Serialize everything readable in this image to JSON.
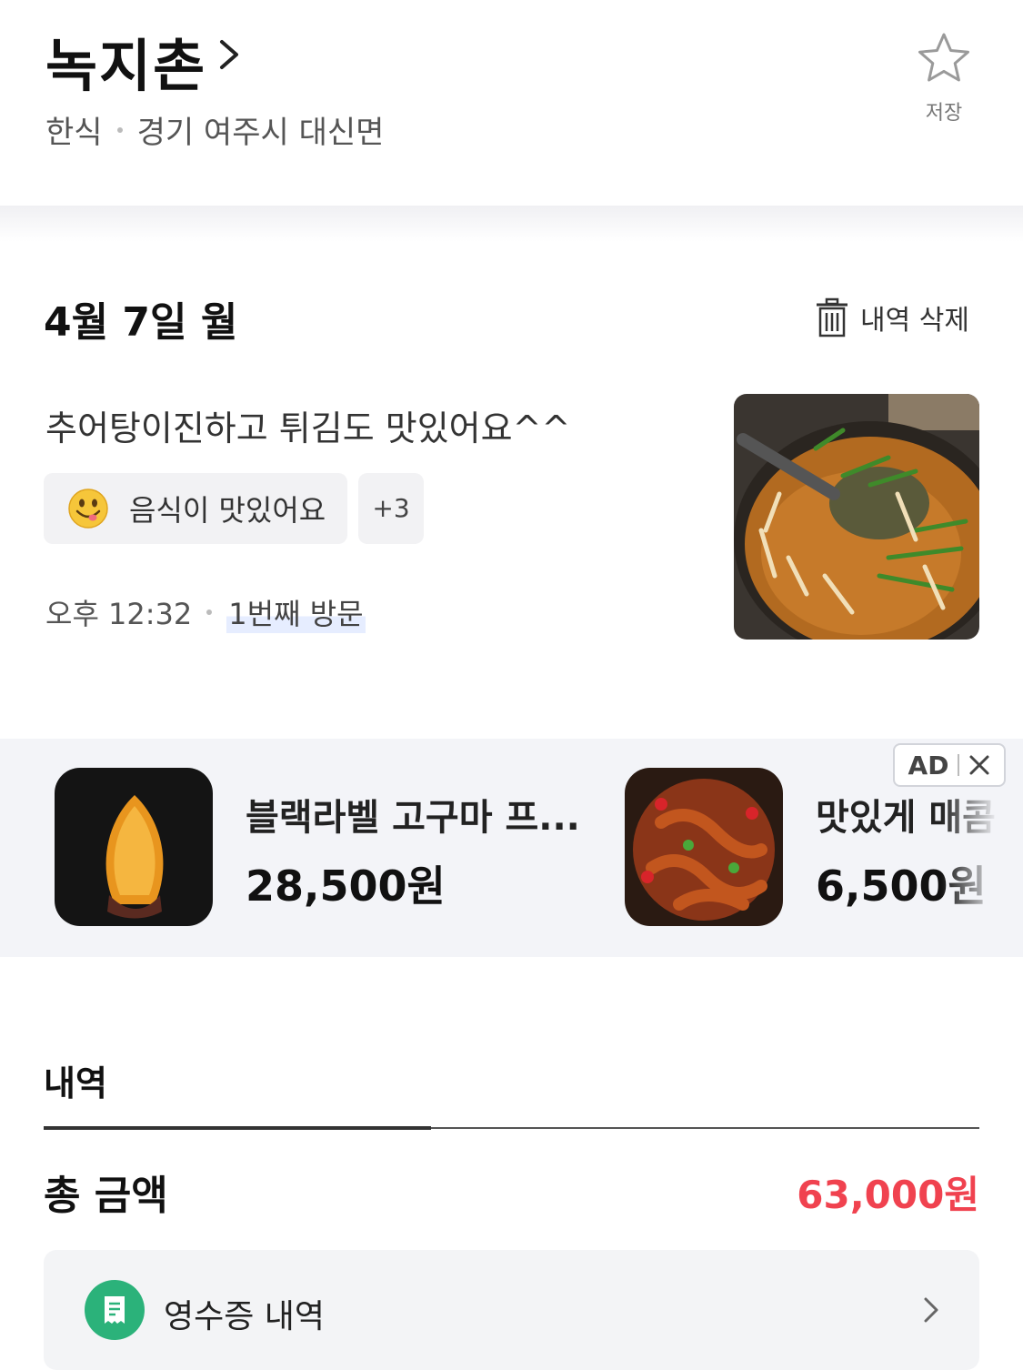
{
  "header": {
    "title": "녹지촌",
    "category": "한식",
    "location": "경기 여주시 대신면",
    "save_label": "저장"
  },
  "visit": {
    "date": "4월 7일 월",
    "delete_label": "내역 삭제",
    "review": "추어탕이진하고 튀김도 맛있어요^^",
    "tag": "음식이 맛있어요",
    "more_tags": "+3",
    "time": "오후 12:32",
    "visit_count": "1번째 방문"
  },
  "ads": {
    "badge": "AD",
    "items": [
      {
        "name": "블랙라벨 고구마 프...",
        "price": "28,500원"
      },
      {
        "name": "맛있게 매콤",
        "price": "6,500원"
      }
    ]
  },
  "history": {
    "section_title": "내역",
    "total_label": "총 금액",
    "total_amount": "63,000원",
    "receipt_label": "영수증 내역"
  },
  "colors": {
    "accent_red": "#f0424f",
    "receipt_green": "#2bb27a",
    "ad_band": "#f3f4f8"
  }
}
